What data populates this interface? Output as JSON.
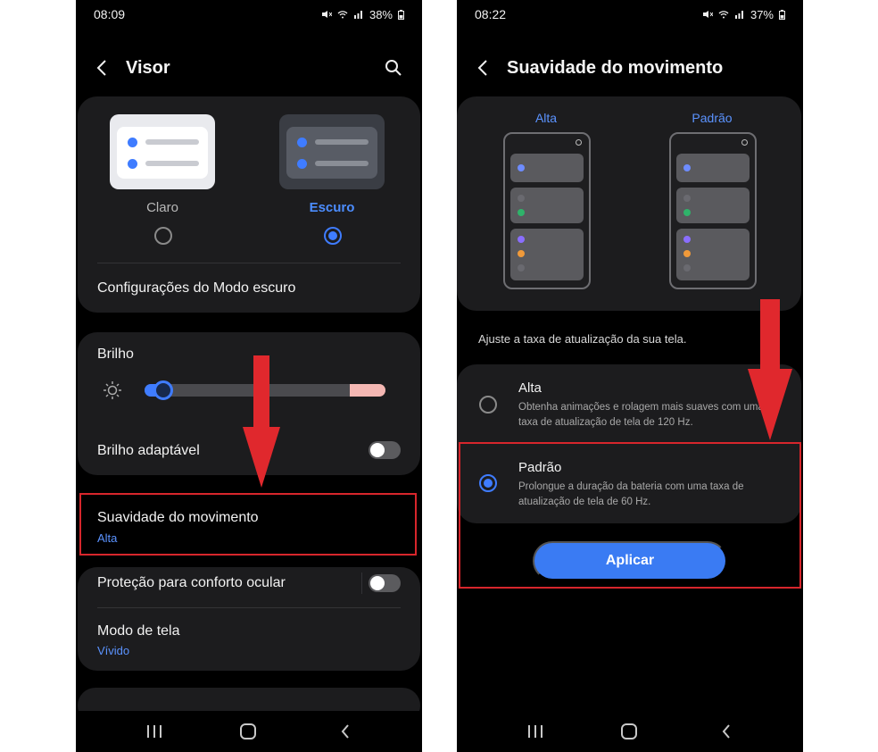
{
  "left_phone": {
    "status": {
      "time": "08:09",
      "battery": "38%"
    },
    "title": "Visor",
    "theme": {
      "light_label": "Claro",
      "dark_label": "Escuro",
      "selected": "Escuro"
    },
    "dark_mode_settings": "Configurações do Modo escuro",
    "brightness": {
      "label": "Brilho",
      "level": 0.08,
      "adaptive_label": "Brilho adaptável",
      "adaptive_on": false
    },
    "motion": {
      "label": "Suavidade do movimento",
      "value": "Alta"
    },
    "eye_comfort": {
      "label": "Proteção para conforto ocular",
      "on": false
    },
    "screen_mode": {
      "label": "Modo de tela",
      "value": "Vívido"
    }
  },
  "right_phone": {
    "status": {
      "time": "08:22",
      "battery": "37%"
    },
    "title": "Suavidade do movimento",
    "preview": {
      "high_label": "Alta",
      "standard_label": "Padrão"
    },
    "caption": "Ajuste a taxa de atualização da sua tela.",
    "options": [
      {
        "title": "Alta",
        "desc": "Obtenha animações e rolagem mais suaves com uma taxa de atualização de tela de 120 Hz.",
        "selected": false
      },
      {
        "title": "Padrão",
        "desc": "Prolongue a duração da bateria com uma taxa de atualização de tela de 60 Hz.",
        "selected": true
      }
    ],
    "apply_label": "Aplicar"
  },
  "colors": {
    "accent": "#3f7cff",
    "highlight_red": "#d7262c",
    "card_bg": "#1c1c1e"
  }
}
